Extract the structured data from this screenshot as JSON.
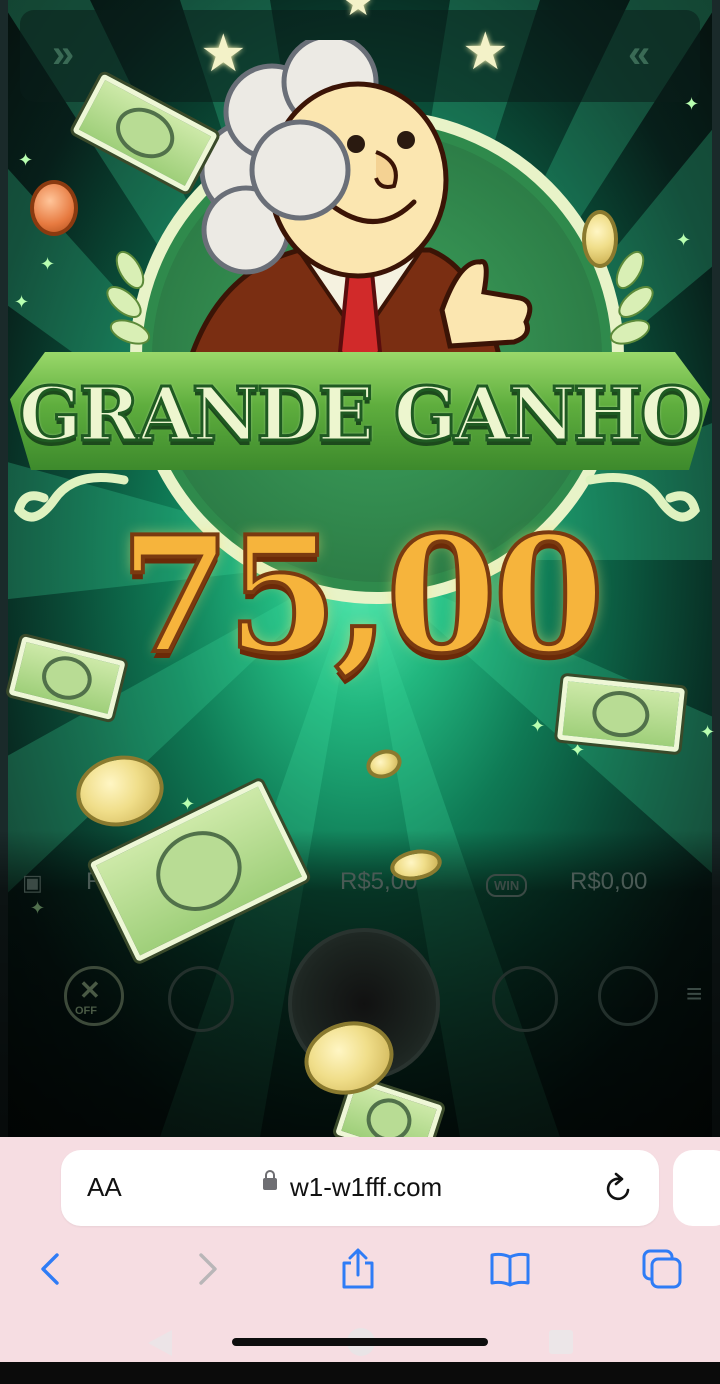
{
  "game": {
    "banner_title": "GRANDE GANHO",
    "win_amount": "75,00",
    "hud": {
      "bet_value": "R$5,00",
      "win_value": "R$0,00",
      "win_badge": "WIN",
      "turbo_label": "OFF",
      "balance_partial": "R"
    }
  },
  "browser": {
    "text_size_button": "AA",
    "url": "w1-w1fff.com",
    "icons": {
      "lock": "lock-icon",
      "reload": "reload-icon",
      "back": "chevron-left-icon",
      "forward": "chevron-right-icon",
      "share": "share-icon",
      "bookmarks": "book-icon",
      "tabs": "tabs-icon"
    },
    "colors": {
      "accent": "#2f7cf6",
      "toolbar_bg": "#f6dde2",
      "disabled": "#b9b6b8"
    }
  }
}
